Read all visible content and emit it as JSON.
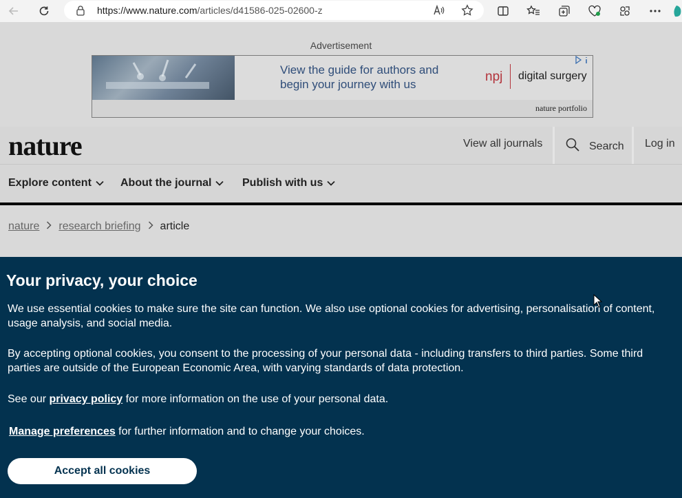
{
  "browser": {
    "url_host": "https://www.nature.com",
    "url_path": "/articles/d41586-025-02600-z"
  },
  "ad": {
    "label": "Advertisement",
    "headline_line1": "View the guide for authors and",
    "headline_line2": "begin your journey with us",
    "brand_npj": "npj",
    "brand_journal": "digital surgery",
    "publisher": "nature portfolio"
  },
  "header": {
    "logo": "nature",
    "view_all_journals": "View all journals",
    "search": "Search",
    "login": "Log in"
  },
  "nav": {
    "items": [
      "Explore content",
      "About the journal",
      "Publish with us"
    ]
  },
  "breadcrumb": {
    "items": [
      "nature",
      "research briefing",
      "article"
    ]
  },
  "cookie": {
    "title": "Your privacy, your choice",
    "para1": "We use essential cookies to make sure the site can function. We also use optional cookies for advertising, personalisation of content, usage analysis, and social media.",
    "para2": "By accepting optional cookies, you consent to the processing of your personal data - including transfers to third parties. Some third parties are outside of the European Economic Area, with varying standards of data protection.",
    "para3_before": "See our ",
    "privacy_link": "privacy policy",
    "para3_after": " for more information on the use of your personal data.",
    "manage_link": "Manage preferences",
    "manage_after": " for further information and to change your choices.",
    "accept_button": "Accept all cookies"
  }
}
